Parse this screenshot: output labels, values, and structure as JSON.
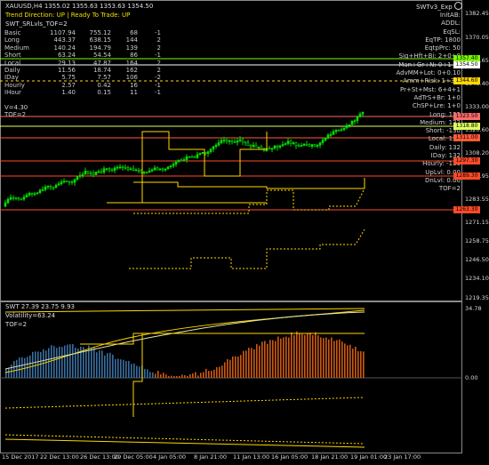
{
  "window": {
    "symbol_line": "XAUUSD,H4  1355.02 1355.63 1353.63 1354.50",
    "ea_label": "SWTv3_Exp"
  },
  "header": {
    "trend_line": "Trend Direction:  UP   |   Ready To Trade:  UP",
    "indicator_name": "SWT_SRLvls_TOF=2"
  },
  "stats": [
    {
      "name": "Basic",
      "a": "1107.94",
      "b": "755.12",
      "c": "68",
      "d": "-1"
    },
    {
      "name": "Long",
      "a": "443.37",
      "b": "638.15",
      "c": "144",
      "d": "2"
    },
    {
      "name": "Medium",
      "a": "140.24",
      "b": "194.79",
      "c": "139",
      "d": "2"
    },
    {
      "name": "Short",
      "a": "63.24",
      "b": "54.54",
      "c": "86",
      "d": "-1"
    },
    {
      "name": "Local",
      "a": "29.13",
      "b": "47.87",
      "c": "164",
      "d": "2"
    },
    {
      "name": "Daily",
      "a": "11.56",
      "b": "18.74",
      "c": "162",
      "d": "2"
    },
    {
      "name": "IDay",
      "a": "5.75",
      "b": "7.57",
      "c": "106",
      "d": "-2"
    },
    {
      "name": "Hourly",
      "a": "2.57",
      "b": "0.42",
      "c": "16",
      "d": "-1"
    },
    {
      "name": "IHour",
      "a": "1.40",
      "b": "0.15",
      "c": "11",
      "d": "-1"
    }
  ],
  "extra": {
    "v_line": "V=4.30",
    "tof_line": "TOF=2"
  },
  "right_panel": [
    "InitAB:",
    "ADDL:",
    "EqSL:",
    "EqTP:  1800",
    "EqtpPrc:  50",
    "Sig+Hft+Bi:  2+0+0",
    "Man+Gr+N:  0+1+2",
    "AdvMM+Lot:  0+0.10",
    "Amm+Risk:  1+3.0",
    "Pr+St+Mst:  6+4+1",
    "AdTrS+Br:  1+0",
    "ChSP+Lre:  1+0",
    "Long:  132",
    "Medium:  132",
    "Short:  -130",
    "Local:  132",
    "Daily:  132",
    "IDay:  132",
    "Hourly:  -130",
    "UpLvl:  0.00",
    "DnLvl:  0.00",
    "TOF=2"
  ],
  "price_axis": [
    "1382.45",
    "1370.05",
    "1357.65",
    "1345.40",
    "1333.00",
    "1320.60",
    "1308.20",
    "1295.95",
    "1283.55",
    "1271.15",
    "1258.75",
    "1246.50",
    "1234.10",
    "1219.35"
  ],
  "price_tags": [
    {
      "label": "1357.40",
      "color": "#7cfc00"
    },
    {
      "label": "1354.50",
      "color": "#ffffff"
    },
    {
      "label": "1344.60",
      "color": "#ffd700"
    },
    {
      "label": "1323.50",
      "color": "#ff6a6a"
    },
    {
      "label": "1318.80",
      "color": "#e0ff60"
    },
    {
      "label": "1311.00",
      "color": "#ff5a3a"
    },
    {
      "label": "1297.30",
      "color": "#ff4a2a"
    },
    {
      "label": "1289.30",
      "color": "#ff4a2a"
    },
    {
      "label": "1263.30",
      "color": "#ff4a2a"
    }
  ],
  "sub_window": {
    "title": "SWT 27.39 23.75 9.93",
    "volatility": "Volatility=63.24",
    "tof": "TOF=2",
    "axis_top": "34.78",
    "axis_zero": "0.00"
  },
  "time_axis": [
    "15 Dec 2017",
    "22 Dec 13:00",
    "26 Dec 13:00",
    "29 Dec 05:00",
    "4 Jan 05:00",
    "8 Jan 21:00",
    "11 Jan 13:00",
    "16 Jan 05:00",
    "18 Jan 21:00",
    "19 Jan 01:00",
    "23 Jan 17:00"
  ],
  "colors": {
    "bull": "#00e000",
    "bear": "#00e000",
    "level_yellow": "#ffd700",
    "level_red": "#e0402a",
    "hist_blue": "#3a6ea0",
    "hist_orange": "#d05a10"
  }
}
